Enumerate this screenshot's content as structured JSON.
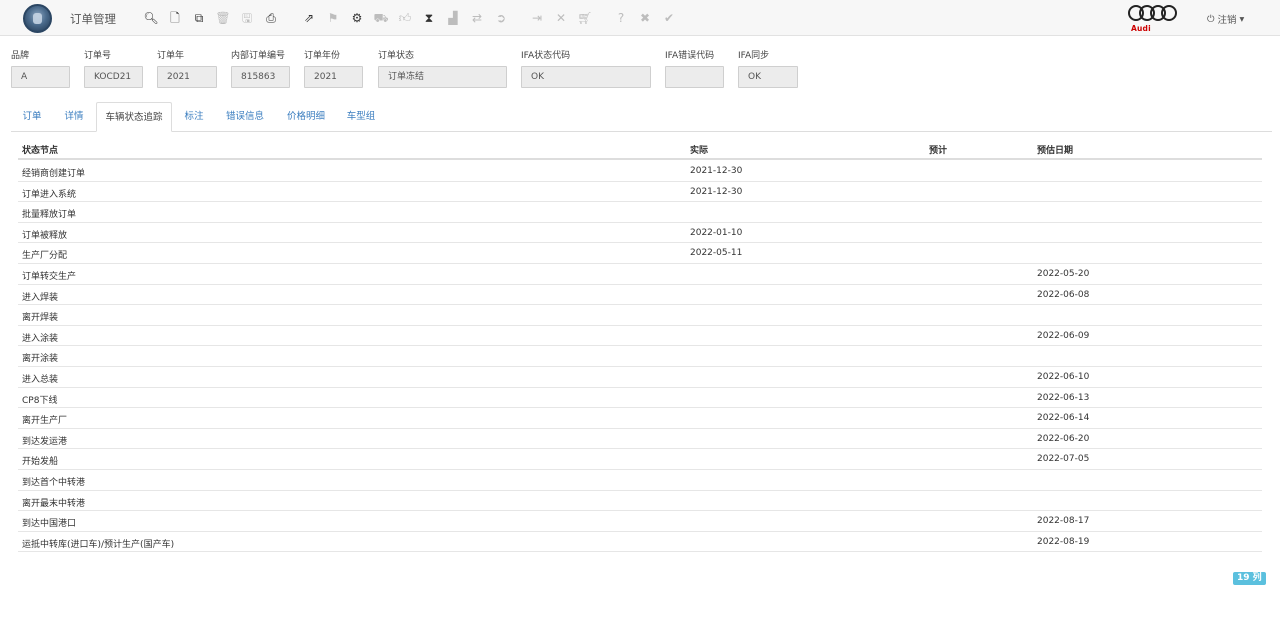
{
  "app": {
    "title": "订单管理"
  },
  "toolbar": {
    "tools": [
      {
        "icon": "search-icon",
        "glyph": "🔍︎",
        "enabled": true
      },
      {
        "icon": "new-document-icon",
        "glyph": "🗋",
        "enabled": true
      },
      {
        "icon": "copy-icon",
        "glyph": "⧉",
        "enabled": true
      },
      {
        "icon": "delete-icon",
        "glyph": "🗑︎",
        "enabled": false
      },
      {
        "icon": "save-icon",
        "glyph": "🖫",
        "enabled": false
      },
      {
        "icon": "print-icon",
        "glyph": "⎙",
        "enabled": true
      },
      {
        "icon": "share-icon",
        "glyph": "⇗",
        "enabled": true
      },
      {
        "icon": "flag-icon",
        "glyph": "⚑",
        "enabled": false
      },
      {
        "icon": "settings-icon",
        "glyph": "⚙",
        "enabled": true
      },
      {
        "icon": "truck-icon",
        "glyph": "⛟",
        "enabled": false
      },
      {
        "icon": "thumbs-up-icon",
        "glyph": "👍︎",
        "enabled": false
      },
      {
        "icon": "hourglass-icon",
        "glyph": "⧗",
        "enabled": true
      },
      {
        "icon": "chart-icon",
        "glyph": "▟",
        "enabled": false
      },
      {
        "icon": "exchange-icon",
        "glyph": "⇄",
        "enabled": false
      },
      {
        "icon": "arrow-right-circle-icon",
        "glyph": "➲",
        "enabled": false
      },
      {
        "icon": "sign-in-icon",
        "glyph": "⇥",
        "enabled": false
      },
      {
        "icon": "close-icon",
        "glyph": "✕",
        "enabled": false
      },
      {
        "icon": "cart-icon",
        "glyph": "🛒︎",
        "enabled": false
      },
      {
        "icon": "help-icon",
        "glyph": "?",
        "enabled": false
      },
      {
        "icon": "cancel-icon",
        "glyph": "✖",
        "enabled": false
      },
      {
        "icon": "check-icon",
        "glyph": "✔",
        "enabled": false
      }
    ]
  },
  "brand": {
    "logo_text": "Audi",
    "color": "#cc0000"
  },
  "user_menu": {
    "power_glyph": "⏻",
    "label": "注销",
    "caret": "▾"
  },
  "fields": [
    {
      "key": "brand",
      "label": "品牌",
      "value": "A"
    },
    {
      "key": "order_no",
      "label": "订单号",
      "value": "KOCD21"
    },
    {
      "key": "order_year",
      "label": "订单年",
      "value": "2021"
    },
    {
      "key": "internal_order_no",
      "label": "内部订单编号",
      "value": "815863"
    },
    {
      "key": "order_year_fiscal",
      "label": "订单年份",
      "value": "2021"
    },
    {
      "key": "order_status",
      "label": "订单状态",
      "value": "订单冻结"
    },
    {
      "key": "ifa_status_code",
      "label": "IFA状态代码",
      "value": "OK"
    },
    {
      "key": "ifa_error_code",
      "label": "IFA错误代码",
      "value": ""
    },
    {
      "key": "ifa_sync",
      "label": "IFA同步",
      "value": "OK"
    }
  ],
  "tabs": [
    {
      "label": "订单",
      "active": false
    },
    {
      "label": "详情",
      "active": false
    },
    {
      "label": "车辆状态追踪",
      "active": true
    },
    {
      "label": "标注",
      "active": false
    },
    {
      "label": "错误信息",
      "active": false
    },
    {
      "label": "价格明细",
      "active": false
    },
    {
      "label": "车型组",
      "active": false
    }
  ],
  "table": {
    "columns": [
      "状态节点",
      "实际",
      "预计",
      "预估日期"
    ],
    "rows": [
      [
        "经销商创建订单",
        "2021-12-30",
        "",
        ""
      ],
      [
        "订单进入系统",
        "2021-12-30",
        "",
        ""
      ],
      [
        "批量释放订单",
        "",
        "",
        ""
      ],
      [
        "订单被释放",
        "2022-01-10",
        "",
        ""
      ],
      [
        "生产厂分配",
        "2022-05-11",
        "",
        ""
      ],
      [
        "订单转交生产",
        "",
        "",
        "2022-05-20"
      ],
      [
        "进入焊装",
        "",
        "",
        "2022-06-08"
      ],
      [
        "离开焊装",
        "",
        "",
        ""
      ],
      [
        "进入涂装",
        "",
        "",
        "2022-06-09"
      ],
      [
        "离开涂装",
        "",
        "",
        ""
      ],
      [
        "进入总装",
        "",
        "",
        "2022-06-10"
      ],
      [
        "CP8下线",
        "",
        "",
        "2022-06-13"
      ],
      [
        "离开生产厂",
        "",
        "",
        "2022-06-14"
      ],
      [
        "到达发运港",
        "",
        "",
        "2022-06-20"
      ],
      [
        "开始发船",
        "",
        "",
        "2022-07-05"
      ],
      [
        "到达首个中转港",
        "",
        "",
        ""
      ],
      [
        "离开最末中转港",
        "",
        "",
        ""
      ],
      [
        "到达中国港口",
        "",
        "",
        "2022-08-17"
      ],
      [
        "运抵中转库(进口车)/预计生产(国产车)",
        "",
        "",
        "2022-08-19"
      ]
    ]
  },
  "footer": {
    "count_label": "19 列"
  }
}
